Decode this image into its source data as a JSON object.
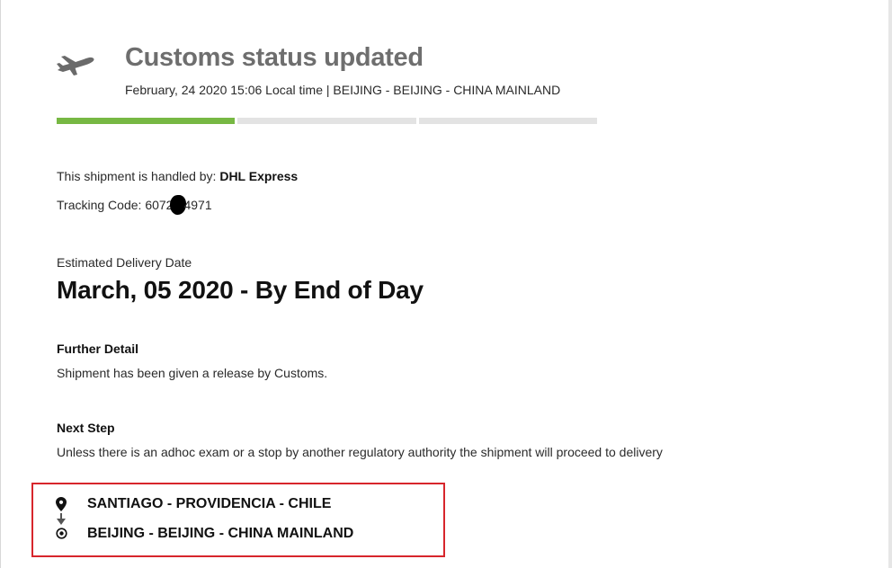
{
  "status": {
    "icon": "airplane-icon",
    "title": "Customs status updated",
    "subtitle": "February, 24 2020 15:06 Local time | BEIJING - BEIJING - CHINA MAINLAND",
    "progress_steps_total": 3,
    "progress_steps_complete": 1
  },
  "shipment": {
    "handled_label": "This shipment is handled by: ",
    "carrier": "DHL Express",
    "tracking_label": "Tracking Code: ",
    "tracking_prefix": "6072",
    "tracking_suffix": "4971"
  },
  "eta": {
    "label": "Estimated Delivery Date",
    "value": "March, 05 2020 - By End of Day"
  },
  "further_detail": {
    "heading": "Further Detail",
    "text": "Shipment has been given a release by Customs."
  },
  "next_step": {
    "heading": "Next Step",
    "text": "Unless there is an adhoc exam or a stop by another regulatory authority the shipment will proceed to delivery"
  },
  "route": {
    "origin": "SANTIAGO - PROVIDENCIA - CHILE",
    "destination": "BEIJING - BEIJING - CHINA MAINLAND",
    "origin_icon": "map-pin-icon",
    "arrow_icon": "arrow-down-icon",
    "destination_icon": "target-icon"
  },
  "colors": {
    "progress_complete": "#77b843",
    "progress_pending": "#e3e3e3",
    "highlight_border": "#d7262c",
    "title_gray": "#6e6e6e"
  }
}
